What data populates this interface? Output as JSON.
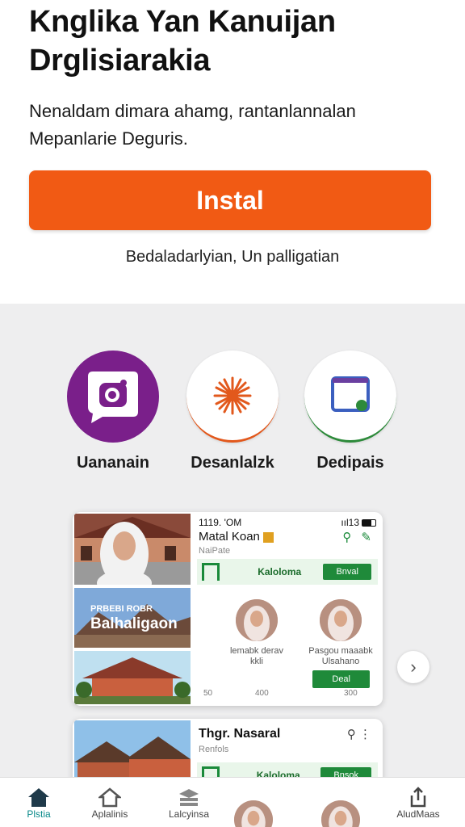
{
  "app": {
    "title_line1": "Knglika Yan Kanuijan",
    "title_line2": "Drglisiarakia",
    "desc_line1": "Nenaldam dimara ahamg, rantanlannalan",
    "desc_line2": "Mepanlarie Deguris.",
    "install_label": "Instal",
    "install_note": "Bedaladarlyian, Un palligatian"
  },
  "categories": [
    {
      "label": "Uananain",
      "icon": "chat-camera-icon",
      "color": "#7a1f8a"
    },
    {
      "label": "Desanlalzk",
      "icon": "sunburst-icon",
      "color": "#e2581c"
    },
    {
      "label": "Dedipais",
      "icon": "frame-icon",
      "color": "#2d8a3a"
    }
  ],
  "card1": {
    "photo_overlay_small": "PRBEBI ROBR",
    "photo_overlay": "Balhaligaon",
    "status_time": "1119. 'OM",
    "status_right": "ııl13",
    "title": "Matal Koan",
    "subtitle": "NaiPate",
    "row_label": "Kaloloma",
    "row_button": "Bnval",
    "people": [
      {
        "name": "lemabk derav kkli"
      },
      {
        "name": "Pasgou maaabk Ulsahano"
      }
    ],
    "nums_left": "50",
    "nums_mid": "400",
    "nums_right": "300",
    "action_button": "Deal"
  },
  "card2": {
    "title": "Thgr. Nasaral",
    "subtitle": "Renfols",
    "row_label": "Kaloloma",
    "row_button": "Bnsok"
  },
  "nav": [
    {
      "label": "Plstia",
      "icon": "home-icon",
      "active": true
    },
    {
      "label": "Aplalinis",
      "icon": "house-outline-icon",
      "active": false
    },
    {
      "label": "Lalcyinsa",
      "icon": "stack-icon",
      "active": false
    },
    {
      "label": "",
      "icon": "avatar",
      "active": false
    },
    {
      "label": "",
      "icon": "avatar",
      "active": false
    },
    {
      "label": "AludMaas",
      "icon": "share-icon",
      "active": false
    }
  ],
  "colors": {
    "install": "#f15a14",
    "green": "#1f8a3a",
    "purple": "#7a1f8a"
  }
}
